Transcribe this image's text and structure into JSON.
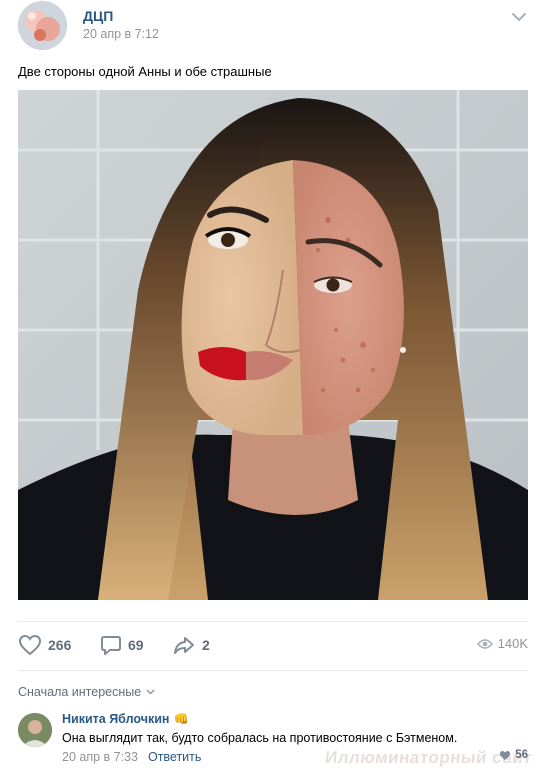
{
  "post": {
    "author": "ДЦП",
    "date": "20 апр в 7:12",
    "text": "Две стороны одной Анны и обе страшные",
    "photo_alt": "photo"
  },
  "actions": {
    "likes": "266",
    "comments": "69",
    "shares": "2",
    "views": "140K"
  },
  "comments_section": {
    "sort_label": "Сначала интересные",
    "items": [
      {
        "author": "Никита Яблочкин",
        "badge": "👊",
        "text": "Она выглядит так, будто собралась на противостояние с Бэтменом.",
        "date": "20 апр в 7:33",
        "reply_label": "Ответить",
        "likes": "56"
      }
    ]
  },
  "watermark": "Иллюминаторный сайт",
  "icons": {
    "menu": "chevron-down-icon",
    "like": "heart-icon",
    "comment": "comment-icon",
    "share": "share-arrow-icon",
    "views": "eye-icon",
    "sort": "chevron-down-small-icon"
  },
  "colors": {
    "link": "#2a5885",
    "muted": "#939393",
    "action": "#626d7a",
    "divider": "#e7e8ec"
  }
}
